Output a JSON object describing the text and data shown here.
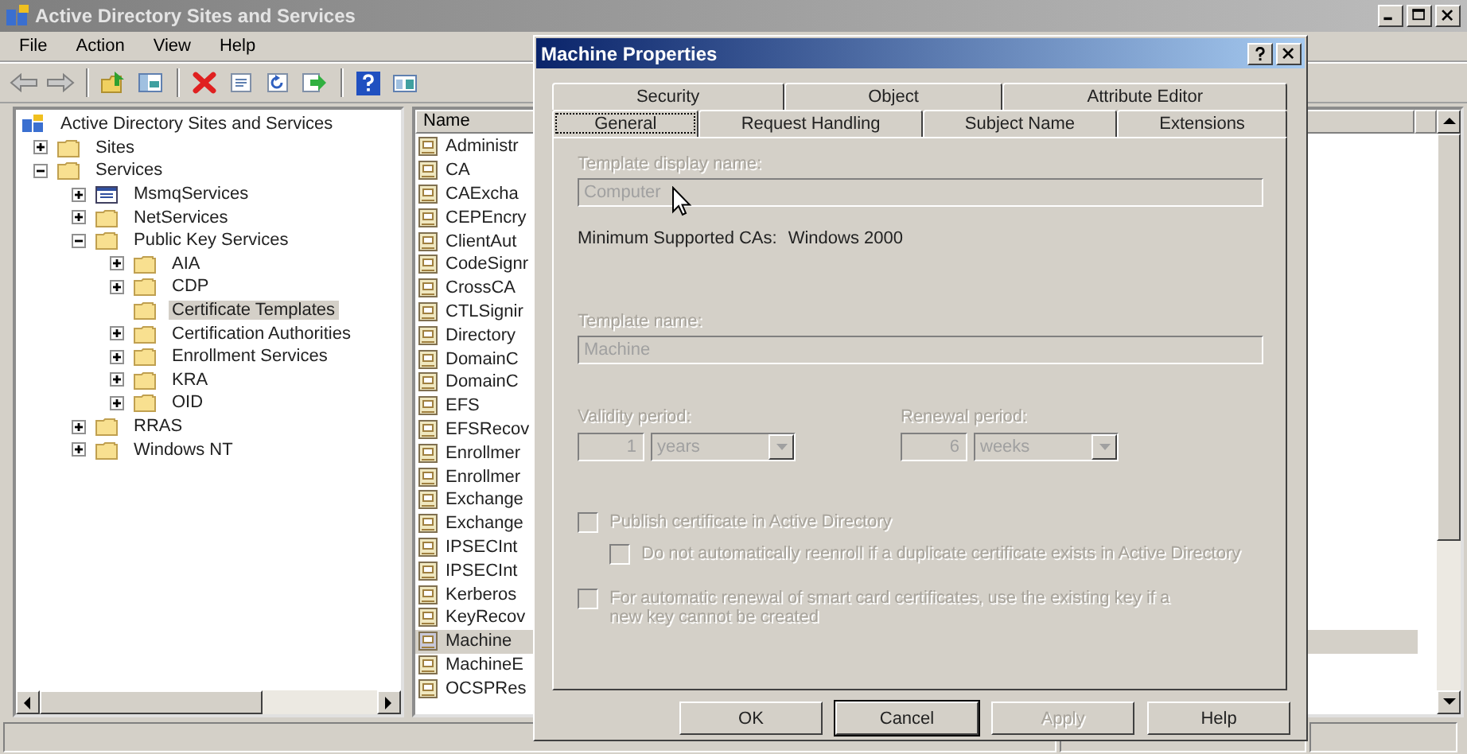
{
  "window": {
    "title": "Active Directory Sites and Services"
  },
  "menu": [
    "File",
    "Action",
    "View",
    "Help"
  ],
  "toolbar": [
    {
      "kind": "back"
    },
    {
      "kind": "forward"
    },
    {
      "kind": "separator"
    },
    {
      "kind": "up"
    },
    {
      "kind": "console"
    },
    {
      "kind": "separator"
    },
    {
      "kind": "delete"
    },
    {
      "kind": "properties"
    },
    {
      "kind": "refresh"
    },
    {
      "kind": "export"
    },
    {
      "kind": "separator"
    },
    {
      "kind": "help"
    },
    {
      "kind": "view"
    }
  ],
  "tree": {
    "items": [
      {
        "label": "Active Directory Sites and Services",
        "kind": "directory",
        "expandable": false,
        "selected": false,
        "children": [
          {
            "label": "Sites",
            "kind": "folder",
            "expandable": true,
            "expanded": false,
            "selected": false
          },
          {
            "label": "Services",
            "kind": "folder",
            "expandable": true,
            "expanded": true,
            "selected": false,
            "children": [
              {
                "label": "MsmqServices",
                "kind": "queue",
                "expandable": true,
                "expanded": false,
                "selected": false
              },
              {
                "label": "NetServices",
                "kind": "folder",
                "expandable": true,
                "expanded": false,
                "selected": false
              },
              {
                "label": "Public Key Services",
                "kind": "folder",
                "expandable": true,
                "expanded": true,
                "selected": false,
                "children": [
                  {
                    "label": "AIA",
                    "kind": "folder",
                    "expandable": true,
                    "expanded": false,
                    "selected": false
                  },
                  {
                    "label": "CDP",
                    "kind": "folder",
                    "expandable": true,
                    "expanded": false,
                    "selected": false
                  },
                  {
                    "label": "Certificate Templates",
                    "kind": "folder",
                    "expandable": false,
                    "selected": true
                  },
                  {
                    "label": "Certification Authorities",
                    "kind": "folder",
                    "expandable": true,
                    "expanded": false,
                    "selected": false
                  },
                  {
                    "label": "Enrollment Services",
                    "kind": "folder",
                    "expandable": true,
                    "expanded": false,
                    "selected": false
                  },
                  {
                    "label": "KRA",
                    "kind": "folder",
                    "expandable": true,
                    "expanded": false,
                    "selected": false
                  },
                  {
                    "label": "OID",
                    "kind": "folder",
                    "expandable": true,
                    "expanded": false,
                    "selected": false
                  }
                ]
              },
              {
                "label": "RRAS",
                "kind": "folder",
                "expandable": true,
                "expanded": false,
                "selected": false
              },
              {
                "label": "Windows NT",
                "kind": "folder",
                "expandable": true,
                "expanded": false,
                "selected": false
              }
            ]
          }
        ]
      }
    ]
  },
  "list": {
    "columns": [
      "Name"
    ],
    "rows": [
      {
        "name": "Administr",
        "selected": false
      },
      {
        "name": "CA",
        "selected": false
      },
      {
        "name": "CAExcha",
        "selected": false
      },
      {
        "name": "CEPEncry",
        "selected": false
      },
      {
        "name": "ClientAut",
        "selected": false
      },
      {
        "name": "CodeSignr",
        "selected": false
      },
      {
        "name": "CrossCA",
        "selected": false
      },
      {
        "name": "CTLSignir",
        "selected": false
      },
      {
        "name": "Directory",
        "selected": false
      },
      {
        "name": "DomainC",
        "selected": false
      },
      {
        "name": "DomainC",
        "selected": false
      },
      {
        "name": "EFS",
        "selected": false
      },
      {
        "name": "EFSRecov",
        "selected": false
      },
      {
        "name": "Enrollmer",
        "selected": false
      },
      {
        "name": "Enrollmer",
        "selected": false
      },
      {
        "name": "Exchange",
        "selected": false
      },
      {
        "name": "Exchange",
        "selected": false
      },
      {
        "name": "IPSECInt",
        "selected": false
      },
      {
        "name": "IPSECInt",
        "selected": false
      },
      {
        "name": "Kerberos",
        "selected": false
      },
      {
        "name": "KeyRecov",
        "selected": false
      },
      {
        "name": "Machine",
        "selected": true
      },
      {
        "name": "MachineE",
        "selected": false
      },
      {
        "name": "OCSPRes",
        "selected": false
      }
    ]
  },
  "dialog": {
    "title": "Machine Properties",
    "tab_rows": [
      {
        "tabs": [
          {
            "label": "Security",
            "selected": false
          },
          {
            "label": "Object",
            "selected": false
          },
          {
            "label": "Attribute Editor",
            "selected": false
          }
        ]
      },
      {
        "tabs": [
          {
            "label": "General",
            "selected": true
          },
          {
            "label": "Request Handling",
            "selected": false
          },
          {
            "label": "Subject Name",
            "selected": false
          },
          {
            "label": "Extensions",
            "selected": false
          }
        ]
      }
    ],
    "display_name": {
      "label": "Template display name:",
      "value": "Computer",
      "disabled": true
    },
    "min_cas": {
      "label": "Minimum Supported CAs:",
      "value": "Windows 2000"
    },
    "template_name": {
      "label": "Template name:",
      "value": "Machine",
      "disabled": true
    },
    "periods": [
      {
        "label": "Validity period:",
        "number": "1",
        "unit": "years",
        "disabled": true
      },
      {
        "label": "Renewal period:",
        "number": "6",
        "unit": "weeks",
        "disabled": true
      }
    ],
    "options": [
      {
        "label": "Publish certificate in Active Directory",
        "checked": false,
        "disabled": true,
        "children": [
          {
            "label": "Do not automatically reenroll if a duplicate certificate exists in Active Directory",
            "checked": false,
            "disabled": true
          }
        ]
      },
      {
        "label": "For automatic renewal of smart card certificates, use the existing key if a new key cannot be created",
        "checked": false,
        "disabled": true
      }
    ],
    "buttons": [
      {
        "label": "OK",
        "default": false,
        "disabled": false
      },
      {
        "label": "Cancel",
        "default": true,
        "disabled": false
      },
      {
        "label": "Apply",
        "default": false,
        "disabled": true
      },
      {
        "label": "Help",
        "default": false,
        "disabled": false
      }
    ]
  }
}
